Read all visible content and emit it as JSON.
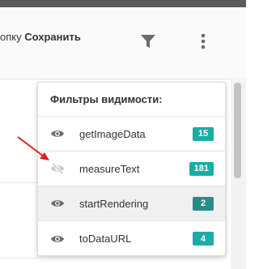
{
  "header": {
    "hint_prefix": "опку",
    "hint_action": "Сохранить"
  },
  "filter_panel": {
    "title": "Фильтры видимости:",
    "items": [
      {
        "label": "getImageData",
        "count": "15",
        "visible": true
      },
      {
        "label": "measureText",
        "count": "181",
        "visible": false
      },
      {
        "label": "startRendering",
        "count": "2",
        "visible": true
      },
      {
        "label": "toDataURL",
        "count": "4",
        "visible": true
      }
    ]
  },
  "colors": {
    "badge": "#1aada6",
    "badge_dark": "#2a8c8a",
    "arrow": "#e02020",
    "eye_visible": "#6b6b6b",
    "eye_hidden": "#c8c8c8"
  },
  "icons": [
    "filter-icon",
    "more-vertical-icon",
    "eye-icon",
    "eye-off-icon",
    "annotation-arrow"
  ]
}
